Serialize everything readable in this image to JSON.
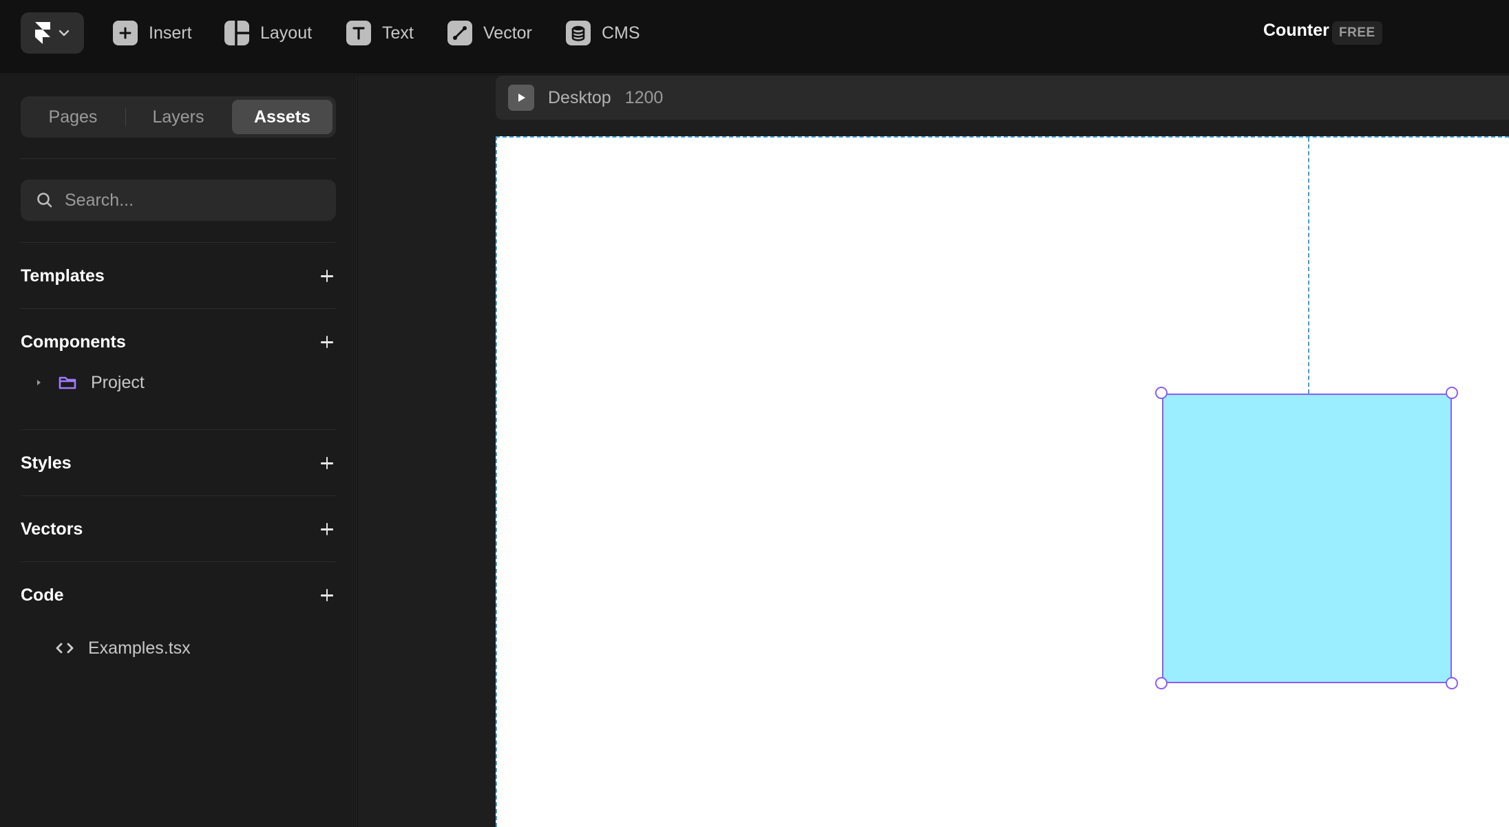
{
  "toolbar": {
    "tools": [
      {
        "label": "Insert",
        "icon": "insert-icon"
      },
      {
        "label": "Layout",
        "icon": "layout-icon"
      },
      {
        "label": "Text",
        "icon": "text-icon"
      },
      {
        "label": "Vector",
        "icon": "vector-icon"
      },
      {
        "label": "CMS",
        "icon": "cms-icon"
      }
    ],
    "project_name": "Counter",
    "plan_badge": "FREE"
  },
  "sidebar": {
    "tabs": [
      {
        "label": "Pages",
        "active": false
      },
      {
        "label": "Layers",
        "active": false
      },
      {
        "label": "Assets",
        "active": true
      }
    ],
    "search_placeholder": "Search...",
    "sections": {
      "templates": "Templates",
      "components": "Components",
      "styles": "Styles",
      "vectors": "Vectors",
      "code": "Code"
    },
    "components_items": [
      {
        "label": "Project",
        "icon": "folder-icon"
      }
    ],
    "code_items": [
      {
        "label": "Examples.tsx",
        "icon": "code-icon"
      }
    ]
  },
  "canvas": {
    "frame_name": "Desktop",
    "frame_width": "1200"
  },
  "colors": {
    "box_fill": "#9aeeff",
    "selection": "#8b5cf6",
    "guide": "#3aa0d8",
    "folder": "#a27bff"
  }
}
